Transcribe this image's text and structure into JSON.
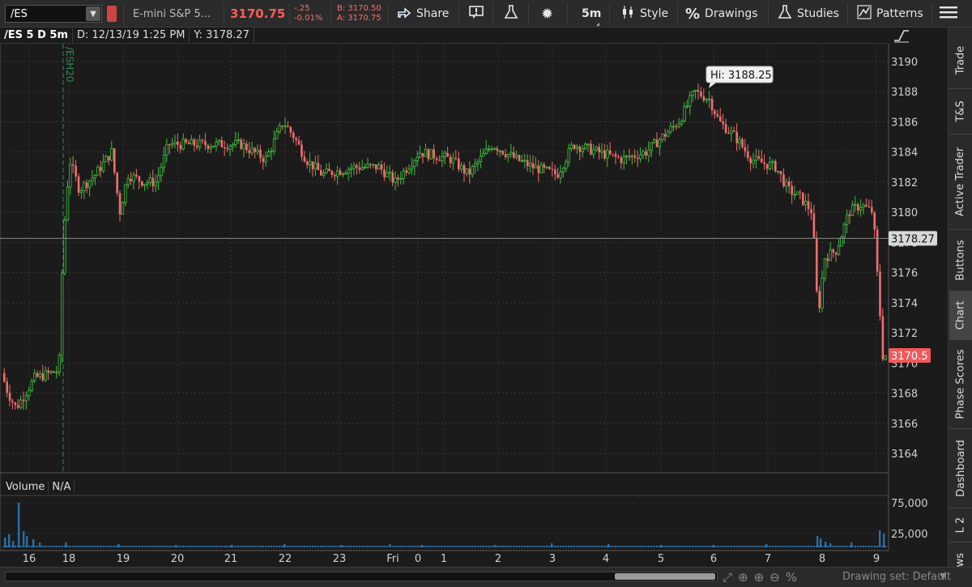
{
  "toolbar": {
    "symbol": "/ES",
    "description": "E-mini S&P 5...",
    "last_price": "3170.75",
    "net_change": "-.25",
    "pct_change": "-0.01%",
    "bid": "B: 3170.50",
    "ask": "A: 3170.75",
    "share_label": "Share",
    "timeframe_label": "5m",
    "style_label": "Style",
    "drawings_label": "Drawings",
    "studies_label": "Studies",
    "patterns_label": "Patterns"
  },
  "header": {
    "symbol_label": "/ES 5 D 5m",
    "date_label": "D: 12/13/19 1:25 PM",
    "y_label": "Y: 3178.27"
  },
  "volume_panel": {
    "label": "Volume",
    "value": "N/A"
  },
  "sidebar_tabs": [
    "Trade",
    "T&S",
    "Active Trader",
    "Buttons",
    "Chart",
    "Phase Scores",
    "Dashboard",
    "L 2",
    "News"
  ],
  "active_tab": "Chart",
  "bottom": {
    "drawing_set_label": "Drawing set: Default"
  },
  "colors": {
    "up": "#3fbf3f",
    "down": "#f26d6d",
    "background": "#1b1b1b",
    "crosshair": "#8a8a8a",
    "contract_line": "#2e8b4f"
  },
  "chart_data": {
    "type": "candlestick",
    "interval": "5m",
    "price_axis_ticks": [
      3164,
      3166,
      3168,
      3170,
      3172,
      3174,
      3176,
      3178,
      3180,
      3182,
      3184,
      3186,
      3188,
      3190
    ],
    "ylim": [
      3162.5,
      3191
    ],
    "volume_axis_ticks": [
      "25,000",
      "75,000"
    ],
    "time_axis_labels": [
      "16",
      "18",
      "19",
      "20",
      "21",
      "22",
      "23",
      "Fri",
      "0",
      "1",
      "2",
      "3",
      "4",
      "5",
      "6",
      "7",
      "8",
      "9"
    ],
    "crosshair_price": "3178.27",
    "last_price_label": "3170.5",
    "high_label": "Hi: 3188.25",
    "contract_marker": "/ESH20",
    "anchors": [
      [
        0,
        3170
      ],
      [
        12,
        3168
      ],
      [
        22,
        3167
      ],
      [
        45,
        3169
      ],
      [
        75,
        3169.5
      ],
      [
        80,
        3178
      ],
      [
        88,
        3183.5
      ],
      [
        100,
        3181.5
      ],
      [
        120,
        3182.5
      ],
      [
        140,
        3184
      ],
      [
        150,
        3180
      ],
      [
        160,
        3182.5
      ],
      [
        180,
        3182
      ],
      [
        195,
        3182
      ],
      [
        210,
        3184.5
      ],
      [
        240,
        3184.5
      ],
      [
        270,
        3184.5
      ],
      [
        300,
        3184.5
      ],
      [
        330,
        3183.5
      ],
      [
        352,
        3186
      ],
      [
        365,
        3185
      ],
      [
        380,
        3183.5
      ],
      [
        400,
        3182.5
      ],
      [
        440,
        3183
      ],
      [
        470,
        3183
      ],
      [
        490,
        3182
      ],
      [
        520,
        3184
      ],
      [
        560,
        3183.5
      ],
      [
        580,
        3182.5
      ],
      [
        610,
        3184.5
      ],
      [
        640,
        3183.5
      ],
      [
        660,
        3183
      ],
      [
        690,
        3182.5
      ],
      [
        710,
        3184.5
      ],
      [
        740,
        3184
      ],
      [
        770,
        3183.5
      ],
      [
        800,
        3184
      ],
      [
        820,
        3185
      ],
      [
        840,
        3186
      ],
      [
        860,
        3188
      ],
      [
        878,
        3187.5
      ],
      [
        890,
        3186
      ],
      [
        910,
        3185
      ],
      [
        930,
        3183.5
      ],
      [
        960,
        3183
      ],
      [
        975,
        3181.5
      ],
      [
        990,
        3181
      ],
      [
        1005,
        3180
      ],
      [
        1012,
        3173
      ],
      [
        1020,
        3177
      ],
      [
        1035,
        3177.5
      ],
      [
        1050,
        3180
      ],
      [
        1065,
        3180.5
      ],
      [
        1080,
        3180
      ],
      [
        1092,
        3170.5
      ]
    ],
    "volume_bars": [
      [
        5,
        12
      ],
      [
        10,
        16
      ],
      [
        15,
        8
      ],
      [
        22,
        55
      ],
      [
        28,
        20
      ],
      [
        32,
        14
      ],
      [
        40,
        10
      ],
      [
        48,
        6
      ],
      [
        80,
        6
      ],
      [
        145,
        4
      ],
      [
        216,
        3
      ],
      [
        285,
        3
      ],
      [
        350,
        4
      ],
      [
        420,
        3
      ],
      [
        480,
        4
      ],
      [
        520,
        3
      ],
      [
        610,
        3
      ],
      [
        680,
        5
      ],
      [
        750,
        4
      ],
      [
        815,
        3
      ],
      [
        880,
        3
      ],
      [
        945,
        4
      ],
      [
        1008,
        14
      ],
      [
        1012,
        11
      ],
      [
        1018,
        7
      ],
      [
        1024,
        5
      ],
      [
        1050,
        6
      ],
      [
        1085,
        21
      ],
      [
        1090,
        17
      ]
    ]
  }
}
